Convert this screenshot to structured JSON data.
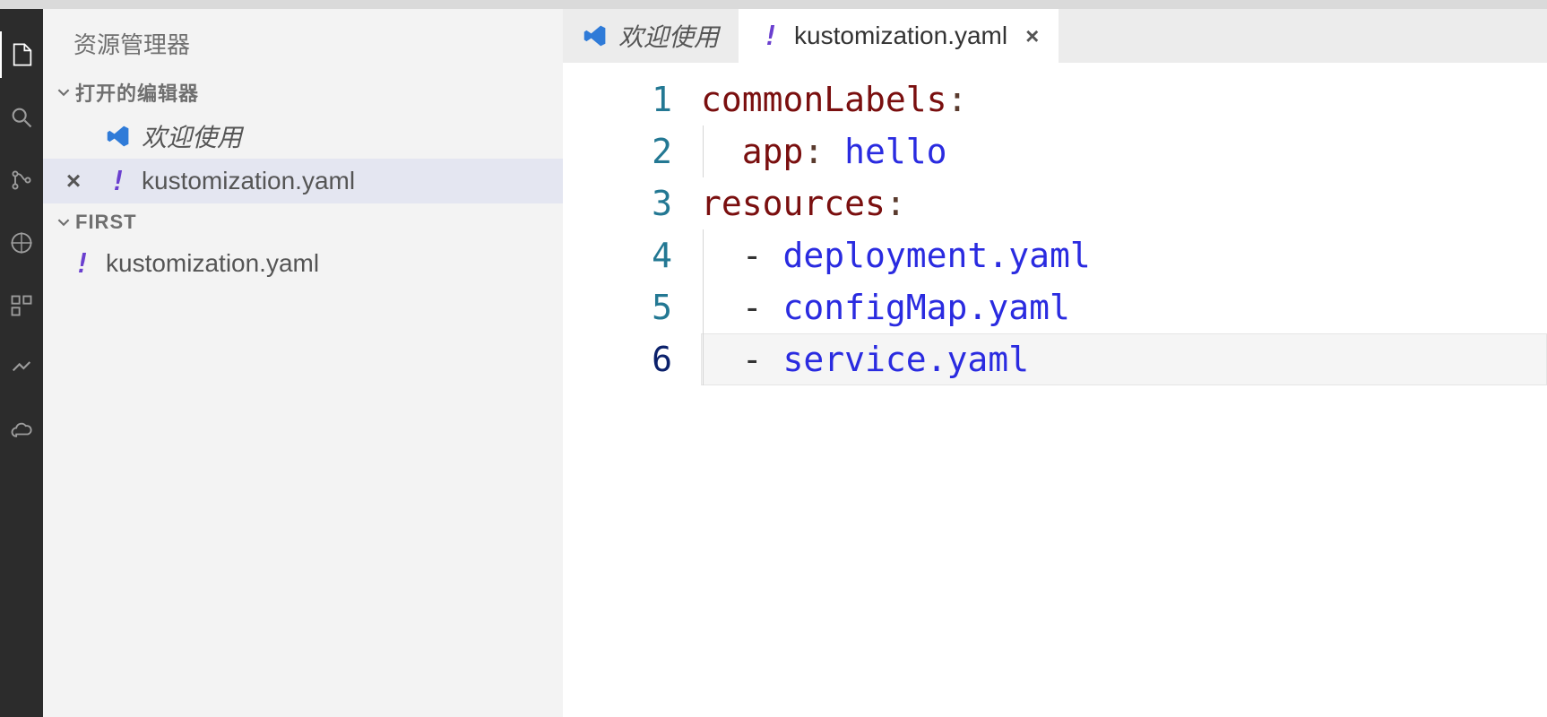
{
  "sidebar": {
    "panel_title": "资源管理器",
    "sections": {
      "open_editors": {
        "label": "打开的编辑器",
        "items": [
          {
            "label": "欢迎使用",
            "icon": "vscode-icon",
            "italic": true,
            "close_visible": false,
            "active": false
          },
          {
            "label": "kustomization.yaml",
            "icon": "exclaim-icon",
            "italic": false,
            "close_visible": true,
            "active": true
          }
        ]
      },
      "folder": {
        "label": "FIRST",
        "items": [
          {
            "label": "kustomization.yaml",
            "icon": "exclaim-icon"
          }
        ]
      }
    }
  },
  "tabs": [
    {
      "label": "欢迎使用",
      "icon": "vscode-icon",
      "active": false,
      "closeable": false
    },
    {
      "label": "kustomization.yaml",
      "icon": "exclaim-icon",
      "active": true,
      "closeable": true
    }
  ],
  "editor": {
    "filename": "kustomization.yaml",
    "language": "yaml",
    "current_line": 6,
    "lines": [
      {
        "n": 1,
        "tokens": [
          {
            "t": "commonLabels",
            "c": "k-key"
          },
          {
            "t": ":",
            "c": "k-colon"
          }
        ],
        "indent": 0
      },
      {
        "n": 2,
        "tokens": [
          {
            "t": "  ",
            "c": ""
          },
          {
            "t": "app",
            "c": "k-key"
          },
          {
            "t": ": ",
            "c": "k-colon"
          },
          {
            "t": "hello",
            "c": "k-str"
          }
        ],
        "indent": 1
      },
      {
        "n": 3,
        "tokens": [
          {
            "t": "resources",
            "c": "k-key"
          },
          {
            "t": ":",
            "c": "k-colon"
          }
        ],
        "indent": 0
      },
      {
        "n": 4,
        "tokens": [
          {
            "t": "  ",
            "c": ""
          },
          {
            "t": "- ",
            "c": "k-dash"
          },
          {
            "t": "deployment.yaml",
            "c": "k-str"
          }
        ],
        "indent": 1
      },
      {
        "n": 5,
        "tokens": [
          {
            "t": "  ",
            "c": ""
          },
          {
            "t": "- ",
            "c": "k-dash"
          },
          {
            "t": "configMap.yaml",
            "c": "k-str"
          }
        ],
        "indent": 1
      },
      {
        "n": 6,
        "tokens": [
          {
            "t": "  ",
            "c": ""
          },
          {
            "t": "- ",
            "c": "k-dash"
          },
          {
            "t": "service.yaml",
            "c": "k-str"
          }
        ],
        "indent": 1
      }
    ]
  },
  "icons": {
    "close_glyph": "×",
    "exclaim_glyph": "!"
  }
}
